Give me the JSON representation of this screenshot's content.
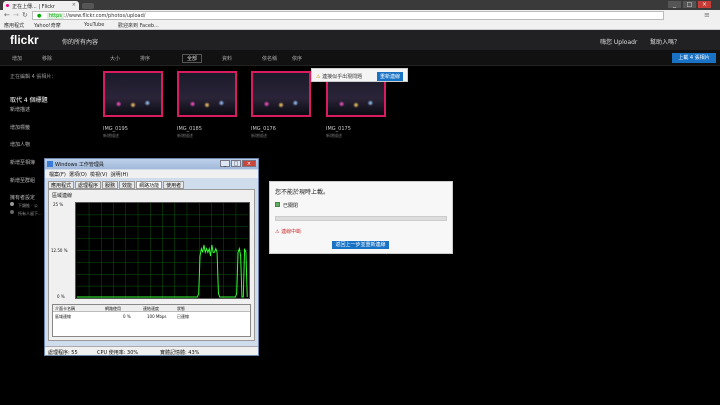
{
  "browser": {
    "tab_title": "正在上傳... | Flickr",
    "tab_close": "×",
    "window_buttons": [
      "_",
      "□",
      "×"
    ],
    "url_scheme": "https",
    "url_rest": "://www.flickr.com/photos/upload/",
    "bookmarks": [
      "應用程式",
      "Yahoo!奇摩",
      "YouTube",
      "歡迎來到 Faceb..."
    ]
  },
  "flickr": {
    "logo": "flickr",
    "nav_left": "你的所有內容",
    "nav_right": [
      "嗨您 Uploadr",
      "幫助入嗎？"
    ],
    "toolbar": [
      "增加",
      "移除",
      "大小",
      "排序",
      "全部",
      "資料",
      "依名稱",
      "依序"
    ],
    "upload_button": "上載 4 張相片",
    "editing_count": "正在編輯 4 張相片：",
    "sidebar": [
      "取代 4 個標題",
      "新增描述",
      "增加標籤",
      "增加人物",
      "新增至相簿",
      "新增至群組",
      "擁有者設定",
      "下類推 · 公",
      "所有人留下..."
    ],
    "thumbnails": [
      {
        "name": "IMG_0195",
        "sub": "新增描述"
      },
      {
        "name": "IMG_0185",
        "sub": "新增描述"
      },
      {
        "name": "IMG_0176",
        "sub": "新增描述"
      },
      {
        "name": "IMG_0175",
        "sub": "新增描述"
      }
    ],
    "notice_text": "連接似乎出現問題",
    "notice_button": "重新連線",
    "dialog": {
      "title": "您不能於現時上載。",
      "checkbox_label": "已關閉",
      "warning": "連線中斷",
      "button": "返回上一步並重新連線"
    }
  },
  "taskmanager": {
    "title": "Windows 工作管理員",
    "title_buttons": [
      "_",
      "□",
      "×"
    ],
    "menu": [
      "檔案(F)",
      "選項(O)",
      "檢視(V)",
      "說明(H)"
    ],
    "tabs": [
      "應用程式",
      "處理程序",
      "服務",
      "效能",
      "網路功能",
      "使用者"
    ],
    "active_tab": "網路功能",
    "panel_label": "區域連線",
    "y_labels": [
      "25 %",
      "12.50 %",
      "0 %"
    ],
    "columns": [
      "介面卡名稱",
      "網路使用",
      "連結速度",
      "狀態"
    ],
    "row": [
      "區域連線",
      "0 %",
      "100 Mbps",
      "已連線"
    ],
    "status": [
      "處理程序: 55",
      "CPU 使用率: 30%",
      "實體記憶體: 43%"
    ]
  },
  "chart_data": {
    "type": "line",
    "title": "",
    "xlabel": "",
    "ylabel": "",
    "ylim": [
      0,
      25
    ],
    "grid": true,
    "series": [
      {
        "values": [
          0,
          0,
          0,
          0,
          0,
          0,
          0,
          0,
          0,
          0,
          0,
          0,
          0,
          0,
          0,
          0,
          0,
          0,
          0,
          0,
          0,
          0,
          0,
          0,
          0,
          0,
          0,
          0,
          0,
          0,
          0,
          0,
          0,
          0,
          0,
          0,
          0,
          0,
          0,
          0,
          0,
          0,
          0,
          0,
          0,
          0,
          0,
          0,
          0,
          0,
          0,
          0,
          0,
          0,
          0,
          0,
          0,
          0,
          0,
          0,
          0,
          0,
          0,
          0,
          0,
          0,
          0,
          0,
          0,
          0,
          0,
          0,
          0,
          0,
          0,
          0,
          0,
          0,
          0,
          0,
          0,
          0,
          0,
          0,
          0,
          0,
          0,
          0,
          0,
          0,
          0,
          0,
          0,
          1,
          11,
          13,
          12,
          14,
          12,
          13,
          12,
          13,
          11,
          14,
          12,
          12,
          13,
          12,
          1,
          0,
          0,
          0,
          0,
          0,
          0,
          0,
          0,
          0,
          0,
          0,
          0,
          0,
          1,
          12,
          13,
          11,
          0,
          0,
          13,
          12,
          0
        ]
      }
    ]
  }
}
